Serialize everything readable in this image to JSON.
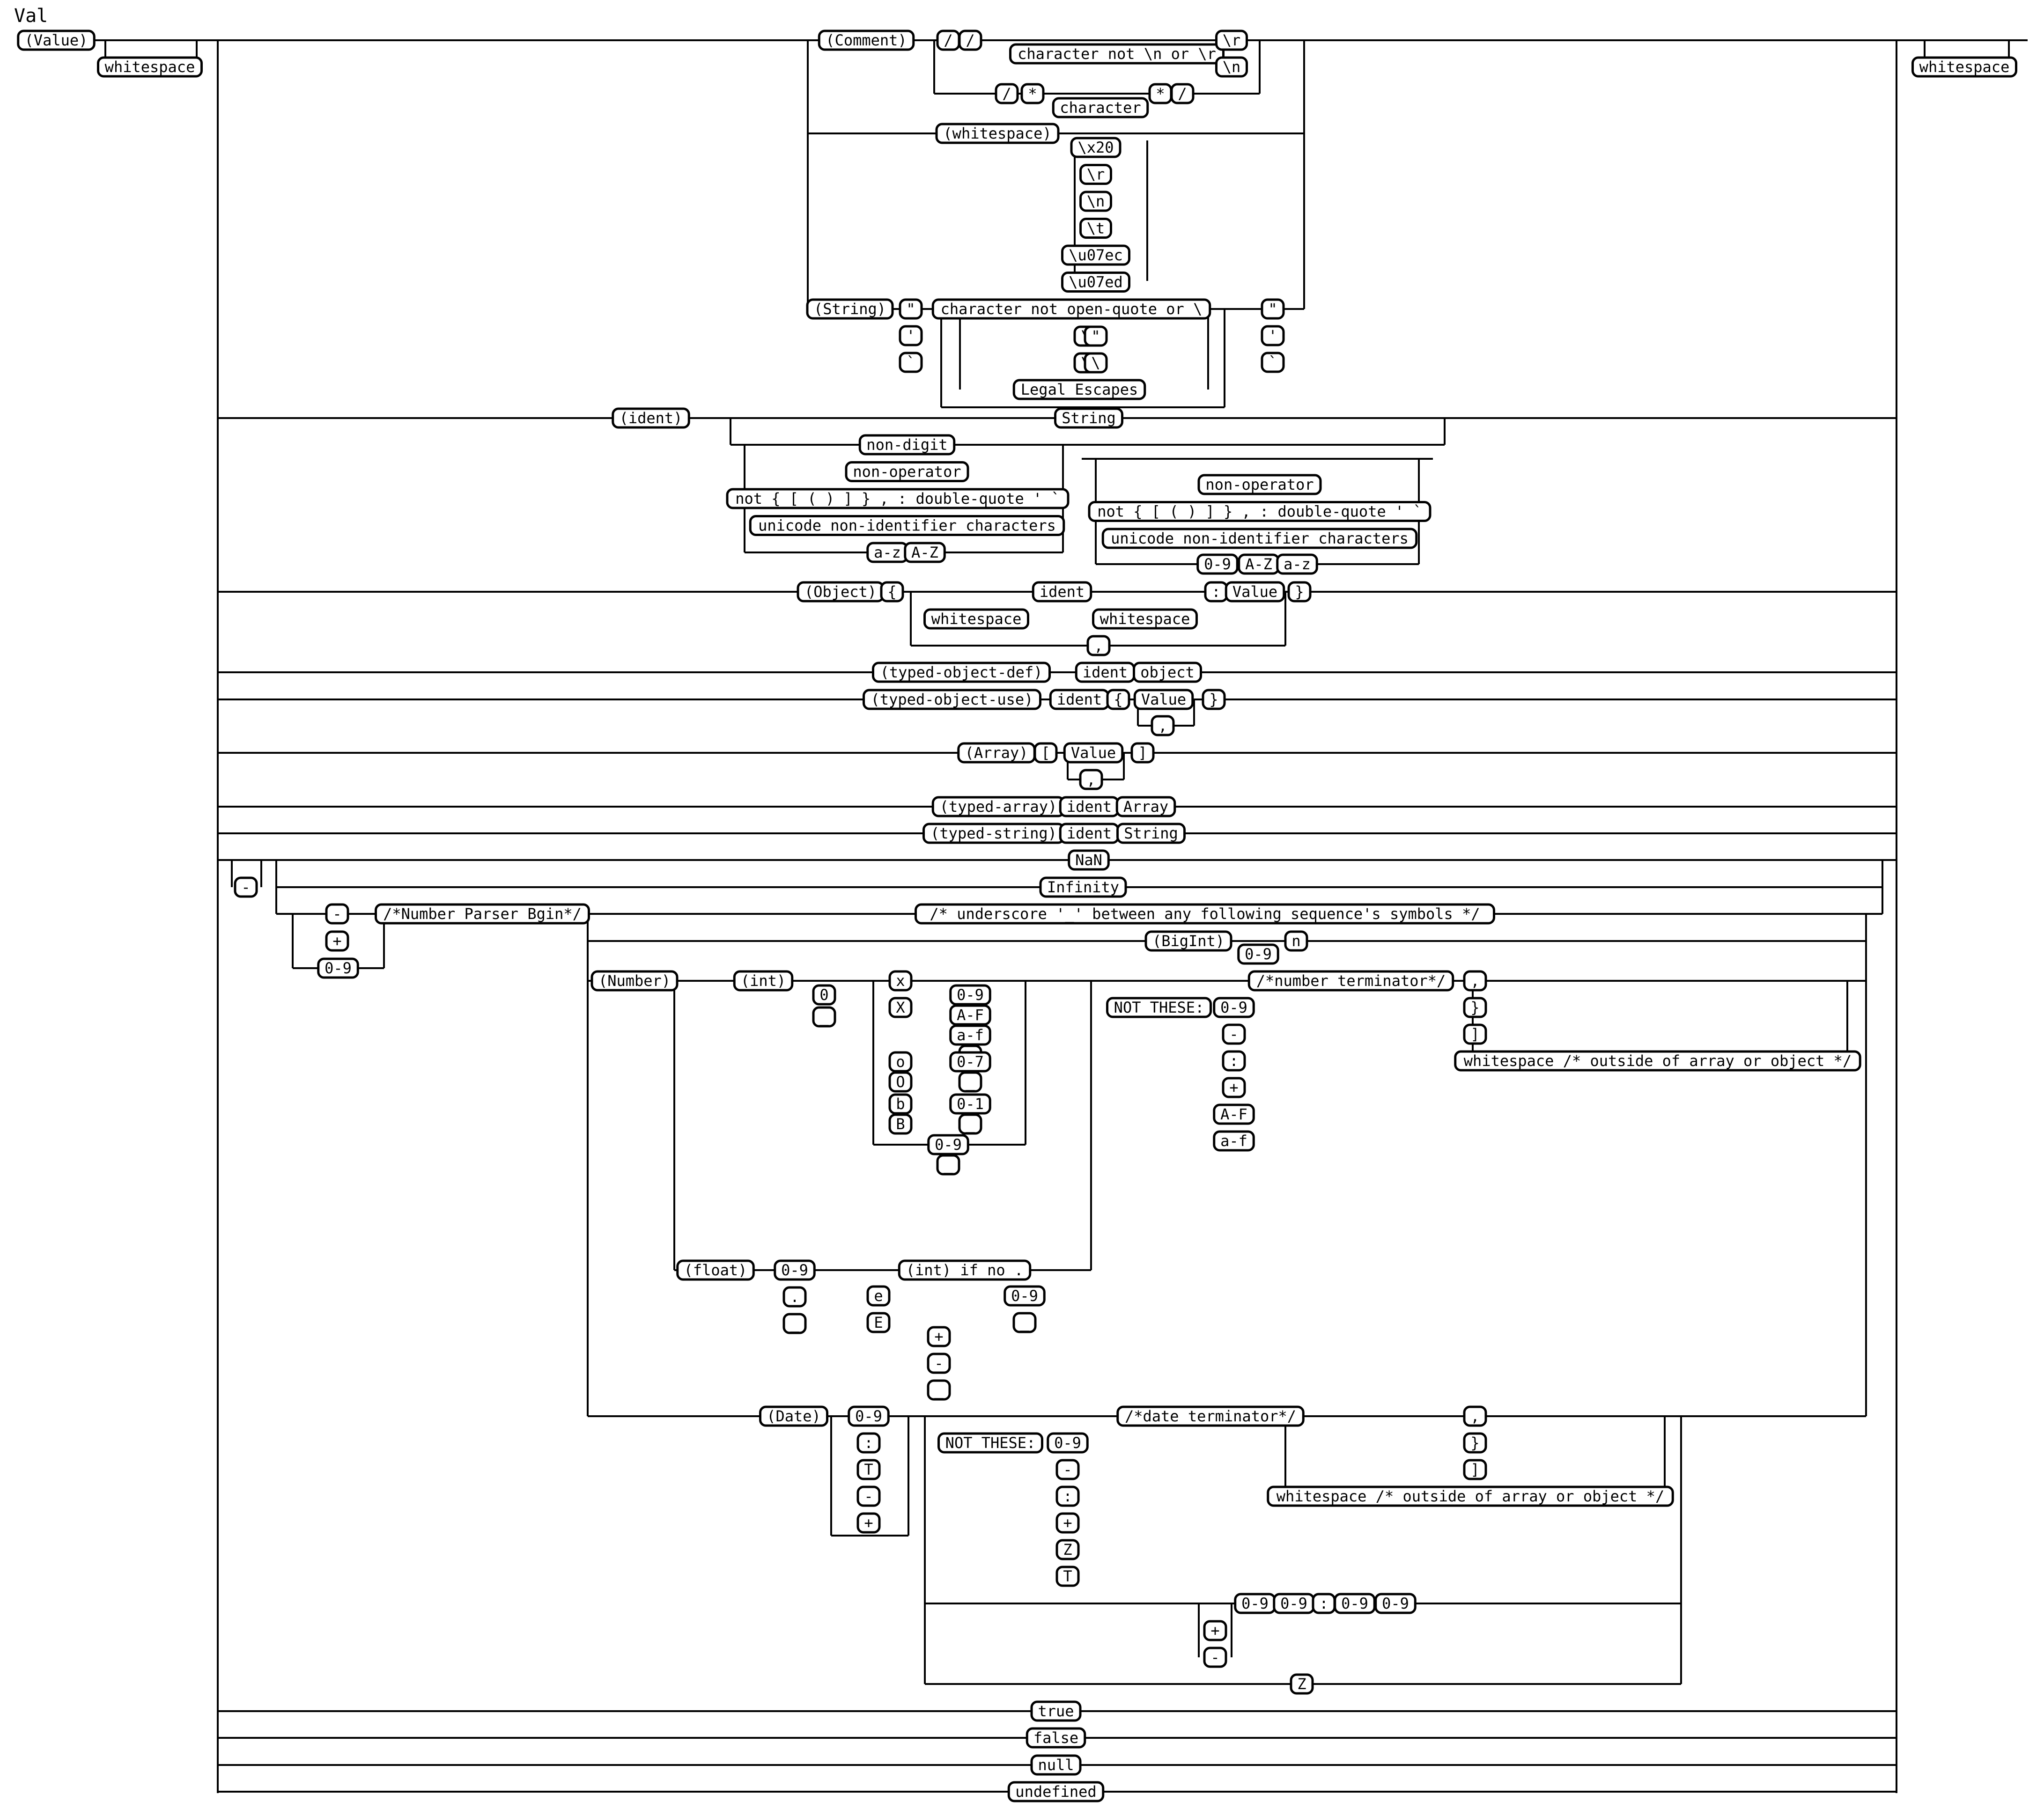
{
  "title": "Val",
  "colors": {
    "line": "#000000",
    "background": "#ffffff",
    "node_fill": "#ffffff"
  },
  "entry": {
    "start": "(Value)",
    "leading_optional": "whitespace",
    "trailing_optional": "whitespace"
  },
  "alternatives": {
    "comment": {
      "label": "(Comment)",
      "line_comment": [
        "/",
        "/",
        "character not \\n or \\r",
        "\\r",
        "\\n"
      ],
      "block_comment": [
        "/",
        "*",
        "character",
        "*",
        "/"
      ]
    },
    "whitespace": {
      "label": "(whitespace)",
      "choices": [
        "\\x20",
        "\\r",
        "\\n",
        "\\t",
        "\\u07ec",
        "\\u07ed"
      ]
    },
    "string": {
      "label": "(String)",
      "open_quotes": [
        "\"",
        "'",
        "`"
      ],
      "body": [
        "character not open-quote or \\",
        "\\",
        "\"",
        "\\",
        "\\",
        "\\",
        "Legal Escapes"
      ],
      "close_quotes": [
        "\"",
        "'",
        "`"
      ]
    },
    "ident": {
      "label": "(ident)",
      "string_alt": "String",
      "first_char": [
        "non-digit",
        "non-operator",
        "not { [ ( ) ] } , : double-quote ' `",
        "unicode non-identifier characters",
        "a-z",
        "A-Z"
      ],
      "rest_chars": [
        "non-operator",
        "not { [ ( ) ] } , : double-quote ' `",
        "unicode non-identifier characters",
        "0-9",
        "A-Z",
        "a-z"
      ]
    },
    "object": {
      "label": "(Object)",
      "open": "{",
      "ws1": "whitespace",
      "key": "ident",
      "ws2": "whitespace",
      "colon": ":",
      "value": "Value",
      "sep": ",",
      "close": "}"
    },
    "typed_object_def": {
      "label": "(typed-object-def)",
      "ident": "ident",
      "object": "object"
    },
    "typed_object_use": {
      "label": "(typed-object-use)",
      "ident": "ident",
      "open": "{",
      "value": "Value",
      "sep": ",",
      "close": "}"
    },
    "array": {
      "label": "(Array)",
      "open": "[",
      "value": "Value",
      "sep": ",",
      "close": "]"
    },
    "typed_array": {
      "label": "(typed-array)",
      "ident": "ident",
      "array": "Array"
    },
    "typed_string": {
      "label": "(typed-string)",
      "ident": "ident",
      "string": "String"
    },
    "numeric": {
      "minus": "-",
      "nan": "NaN",
      "infinity": "Infinity",
      "sign": [
        "-",
        "+"
      ],
      "digit": "0-9",
      "parser_begin": "/*Number Parser Bgin*/",
      "underscore_comment": "/*  underscore '_' between any following sequence's symbols */",
      "bigint": {
        "label": "(BigInt)",
        "digits": "0-9",
        "suffix": "n"
      },
      "number": {
        "label": "(Number)",
        "int": {
          "label": "(int)",
          "zero": [
            "0",
            "_"
          ],
          "hex": {
            "prefix": [
              "x",
              "X"
            ],
            "digits": [
              "0-9",
              "A-F",
              "a-f",
              "_"
            ]
          },
          "octal": {
            "prefix": [
              "o",
              "O"
            ],
            "digits": [
              "0-7",
              "_"
            ]
          },
          "binary": {
            "prefix": [
              "b",
              "B"
            ],
            "digits": [
              "0-1",
              "_"
            ]
          },
          "decimal": [
            "0-9",
            "_"
          ]
        },
        "float": {
          "label": "(float)",
          "mantissa": [
            "0-9",
            ".",
            "_"
          ],
          "int_if_no_dot": "(int) if no .",
          "exp": [
            "e",
            "E"
          ],
          "exp_sign": [
            "+",
            "-",
            "_"
          ],
          "exp_digits": [
            "0-9",
            "_"
          ]
        },
        "not_these": {
          "label": "NOT THESE:",
          "chars": [
            "0-9",
            "-",
            ":",
            "+",
            "A-F",
            "a-f"
          ]
        },
        "terminator": {
          "label": "/*number terminator*/",
          "choices": [
            ",",
            "}",
            "]",
            "whitespace /* outside of array or object */"
          ]
        }
      },
      "date": {
        "label": "(Date)",
        "chars": [
          "0-9",
          ":",
          "T",
          "-",
          "+"
        ],
        "not_these": {
          "label": "NOT THESE:",
          "chars": [
            "0-9",
            "-",
            ":",
            "+",
            "Z",
            "T"
          ]
        },
        "terminator": {
          "label": "/*date terminator*/",
          "choices": [
            ",",
            "}",
            "]",
            "whitespace /* outside of array or object */"
          ]
        },
        "offset_sign": [
          "+",
          "-"
        ],
        "offset": [
          "0-9",
          "0-9",
          ":",
          "0-9",
          "0-9"
        ],
        "zulu": "Z"
      }
    },
    "literals": [
      "true",
      "false",
      "null",
      "undefined"
    ]
  }
}
